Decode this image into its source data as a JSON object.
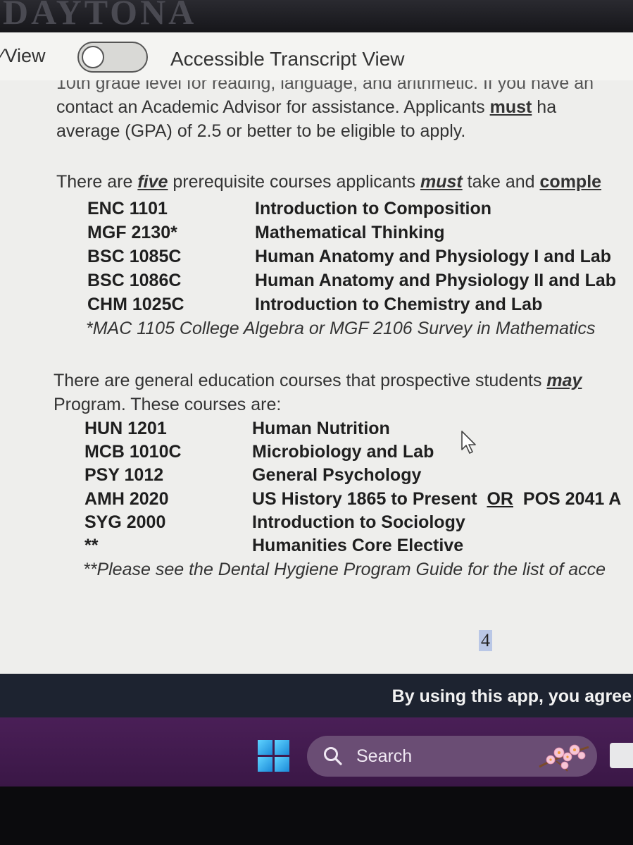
{
  "bezel": {
    "brand": "DAYTONA"
  },
  "viewbar": {
    "view_label": "View",
    "toggle_on": false,
    "accessible_label": "Accessible Transcript View"
  },
  "document": {
    "cut_line": "10th grade level for reading, language, and arithmetic. If you have an",
    "p1": {
      "a": "contact an Academic Advisor for assistance.  Applicants ",
      "b": "must",
      "c": " ha"
    },
    "p2": "average (GPA) of 2.5 or better to be eligible to apply.",
    "p3": {
      "a": "There are ",
      "b": "five",
      "c": " prerequisite courses applicants ",
      "d": "must",
      "e": " take and ",
      "f": "comple"
    },
    "prerequisites": [
      {
        "code": "ENC 1101",
        "title": "Introduction to Composition"
      },
      {
        "code": "MGF 2130*",
        "title": "Mathematical Thinking"
      },
      {
        "code": "BSC 1085C",
        "title": "Human Anatomy and Physiology I and Lab"
      },
      {
        "code": "BSC 1086C",
        "title": "Human Anatomy and Physiology II and Lab"
      },
      {
        "code": "CHM 1025C",
        "title": "Introduction to Chemistry and Lab"
      }
    ],
    "prereq_note": "*MAC 1105 College Algebra or MGF 2106 Survey in Mathematics",
    "p4": {
      "a": "There are general education courses that prospective students ",
      "b": "may"
    },
    "p5": "Program. These courses are:",
    "gen_ed": [
      {
        "code": "HUN 1201",
        "title": "Human Nutrition"
      },
      {
        "code": "MCB 1010C",
        "title": "Microbiology and Lab"
      },
      {
        "code": "PSY 1012",
        "title": "General Psychology"
      },
      {
        "code": "AMH 2020",
        "title": "US History 1865 to Present",
        "or": "OR",
        "alt": "POS 2041 A"
      },
      {
        "code": "SYG 2000",
        "title": "Introduction to Sociology"
      },
      {
        "code": "**",
        "title": "Humanities Core Elective"
      }
    ],
    "gen_ed_note": "**Please see the Dental Hygiene Program Guide for the list of acce",
    "page_number": "4"
  },
  "banner": {
    "text": "By using this app, you agree"
  },
  "taskbar": {
    "search_label": "Search"
  },
  "colors": {
    "taskbar": "#4a1f57",
    "banner": "#1d2330",
    "page_bg": "#eeeeec"
  }
}
